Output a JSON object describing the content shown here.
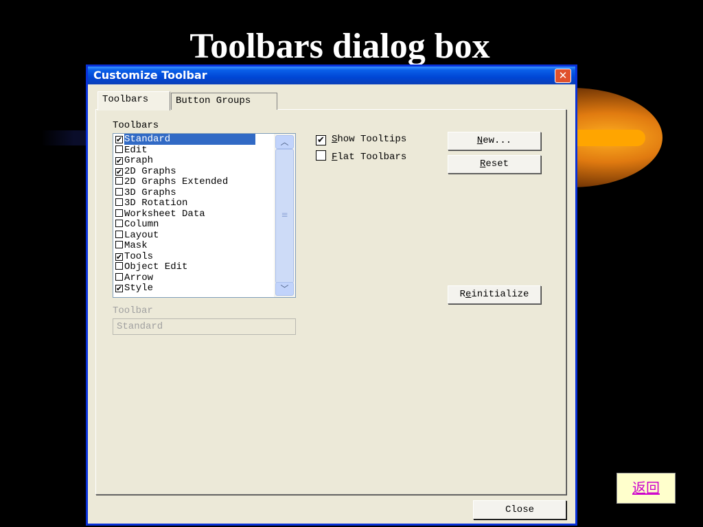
{
  "slide": {
    "title": "Toolbars dialog box",
    "return_link": "返回"
  },
  "colors": {
    "titlebar": "#0a5fe8",
    "selection": "#316ac5",
    "dialog_bg": "#ece9d8",
    "link": "#cc00cc"
  },
  "dialog": {
    "title": "Customize Toolbar",
    "close_glyph": "✕",
    "tabs": [
      {
        "label": "Toolbars"
      },
      {
        "label": "Button Groups"
      }
    ],
    "toolbars_group_label": "Toolbars",
    "list": [
      {
        "label": "Standard",
        "checked": true,
        "selected": true
      },
      {
        "label": "Edit",
        "checked": false
      },
      {
        "label": "Graph",
        "checked": true
      },
      {
        "label": "2D Graphs",
        "checked": true
      },
      {
        "label": "2D Graphs Extended",
        "checked": false
      },
      {
        "label": "3D Graphs",
        "checked": false
      },
      {
        "label": "3D Rotation",
        "checked": false
      },
      {
        "label": "Worksheet Data",
        "checked": false
      },
      {
        "label": "Column",
        "checked": false
      },
      {
        "label": "Layout",
        "checked": false
      },
      {
        "label": "Mask",
        "checked": false
      },
      {
        "label": "Tools",
        "checked": true
      },
      {
        "label": "Object Edit",
        "checked": false
      },
      {
        "label": "Arrow",
        "checked": false
      },
      {
        "label": "Style",
        "checked": true
      }
    ],
    "options": {
      "show_tooltips": {
        "label_first": "S",
        "label_rest": "how Tooltips",
        "checked": true
      },
      "flat_toolbars": {
        "label_first": "F",
        "label_rest": "lat Toolbars",
        "checked": false
      }
    },
    "buttons": {
      "new": {
        "first": "N",
        "rest": "ew..."
      },
      "reset": {
        "first": "R",
        "rest": "eset"
      },
      "reinitialize": {
        "pre": "R",
        "under": "e",
        "rest": "initialize"
      },
      "close": "Close"
    },
    "toolbar_field": {
      "label": "Toolbar",
      "value": "Standard"
    }
  }
}
